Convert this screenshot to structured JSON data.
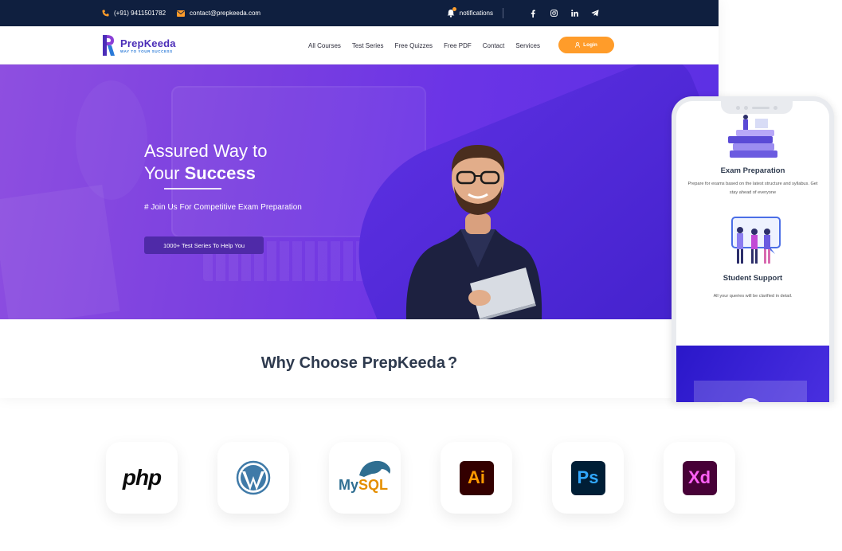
{
  "topbar": {
    "phone": "(+91) 9411501782",
    "email": "contact@prepkeeda.com",
    "notifications": "notifications",
    "socials": [
      "facebook-icon",
      "instagram-icon",
      "linkedin-icon",
      "telegram-icon"
    ]
  },
  "brand": {
    "name_prefix": "Prep",
    "name_suffix": "Keeda",
    "tagline": "WAY TO YOUR SUCCESS",
    "primary_color": "#4b2db8",
    "accent_color": "#ff9c2a"
  },
  "nav": {
    "items": [
      "All Courses",
      "Test Series",
      "Free Quizzes",
      "Free PDF",
      "Contact",
      "Services"
    ],
    "login": "Login"
  },
  "hero": {
    "title_line1": "Assured Way to",
    "title_line2_normal": "Your ",
    "title_line2_bold": "Success",
    "subtitle": "# Join Us For Competitive Exam Preparation",
    "button": "1000+ Test Series To Help You"
  },
  "why": {
    "title": "Why Choose PrepKeeda",
    "mark": "?"
  },
  "phone": {
    "features": [
      {
        "title": "Exam Preparation",
        "desc": "Prepare for exams based on the latest structure and syllabus. Get stay ahead of everyone"
      },
      {
        "title": "Student Support",
        "desc": "All your queries will be clarified in detail."
      }
    ]
  },
  "tech": {
    "php": "php",
    "mysql_my": "My",
    "mysql_sql": "SQL",
    "ai": "Ai",
    "ps": "Ps",
    "xd": "Xd"
  }
}
